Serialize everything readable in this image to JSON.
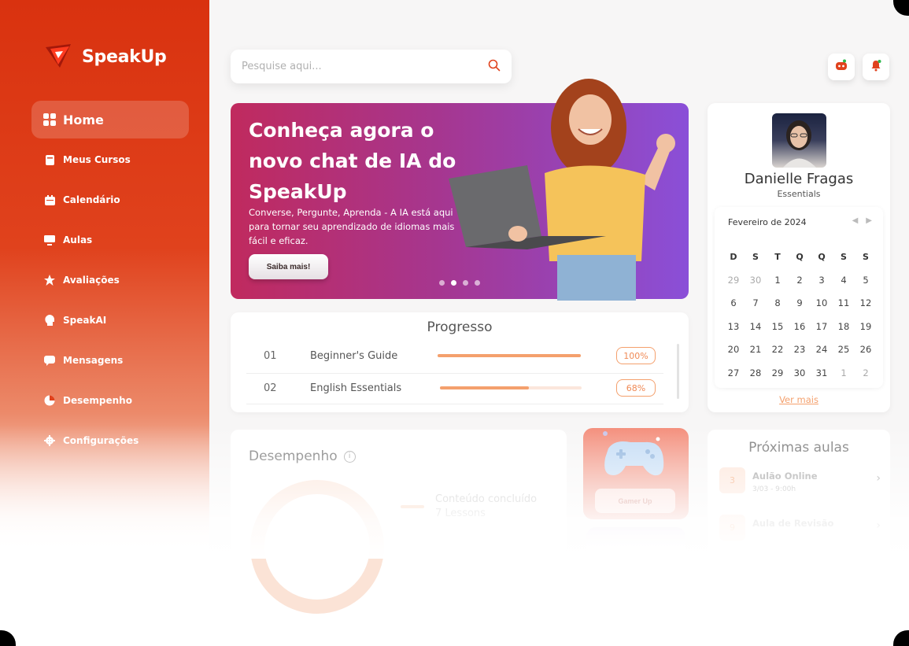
{
  "brand": {
    "name": "SpeakUp",
    "accent": "#e0421d"
  },
  "nav": {
    "items": [
      {
        "label": "Home",
        "icon": "grid-icon",
        "active": true
      },
      {
        "label": "Meus Cursos",
        "icon": "book-icon"
      },
      {
        "label": "Calendário",
        "icon": "calendar-icon"
      },
      {
        "label": "Aulas",
        "icon": "monitor-icon"
      },
      {
        "label": "Avaliações",
        "icon": "star-icon"
      },
      {
        "label": "SpeakAI",
        "icon": "ai-head-icon"
      },
      {
        "label": "Mensagens",
        "icon": "message-icon"
      },
      {
        "label": "Desempenho",
        "icon": "pie-chart-icon"
      },
      {
        "label": "Configurações",
        "icon": "gear-icon"
      }
    ]
  },
  "search": {
    "placeholder": "Pesquise aqui..."
  },
  "banner": {
    "title": "Conheça agora o novo chat de IA do SpeakUp",
    "subtitle": "Converse, Pergunte, Aprenda - A IA está aqui para tornar seu aprendizado de idiomas mais fácil e eficaz.",
    "button": "Saiba mais!",
    "slides": 4,
    "active_slide": 2
  },
  "progress": {
    "title": "Progresso",
    "rows": [
      {
        "num": "01",
        "name": "Beginner's Guide",
        "pct_label": "100%",
        "pct": 1.0
      },
      {
        "num": "02",
        "name": "English Essentials",
        "pct_label": "68%",
        "pct": 0.63
      }
    ]
  },
  "profile": {
    "name": "Danielle Fragas",
    "tier": "Essentials",
    "calendar": {
      "month": "Fevereiro de 2024",
      "weekdays": [
        "D",
        "S",
        "T",
        "Q",
        "Q",
        "S",
        "S"
      ],
      "weeks": [
        [
          {
            "d": "29",
            "m": true
          },
          {
            "d": "30",
            "m": true
          },
          {
            "d": "1"
          },
          {
            "d": "2"
          },
          {
            "d": "3",
            "hl": "orange"
          },
          {
            "d": "4"
          },
          {
            "d": "5"
          }
        ],
        [
          {
            "d": "6"
          },
          {
            "d": "7",
            "hl": "orange"
          },
          {
            "d": "8"
          },
          {
            "d": "9"
          },
          {
            "d": "10"
          },
          {
            "d": "11",
            "hl": "purple"
          },
          {
            "d": "12"
          }
        ],
        [
          {
            "d": "13"
          },
          {
            "d": "14"
          },
          {
            "d": "15"
          },
          {
            "d": "16"
          },
          {
            "d": "17"
          },
          {
            "d": "18"
          },
          {
            "d": "19"
          }
        ],
        [
          {
            "d": "20"
          },
          {
            "d": "21"
          },
          {
            "d": "22",
            "hl": "purple"
          },
          {
            "d": "23"
          },
          {
            "d": "24",
            "hl": "purple"
          },
          {
            "d": "25"
          },
          {
            "d": "26"
          }
        ],
        [
          {
            "d": "27"
          },
          {
            "d": "28"
          },
          {
            "d": "29"
          },
          {
            "d": "30"
          },
          {
            "d": "31"
          },
          {
            "d": "1",
            "m": true
          },
          {
            "d": "2",
            "m": true
          }
        ]
      ]
    },
    "more_link": "Ver mais"
  },
  "desempenho": {
    "title": "Desempenho",
    "legend_label": "Conteúdo concluído",
    "legend_value": "7 Lessons"
  },
  "gamer": {
    "button": "Gamer Up"
  },
  "aulas": {
    "title": "Próximas aulas",
    "items": [
      {
        "badge": "3",
        "name": "Aulão Online",
        "time": "3/03 - 9:00h"
      },
      {
        "badge": "9",
        "name": "Aula de Revisão",
        "time": ""
      }
    ]
  }
}
